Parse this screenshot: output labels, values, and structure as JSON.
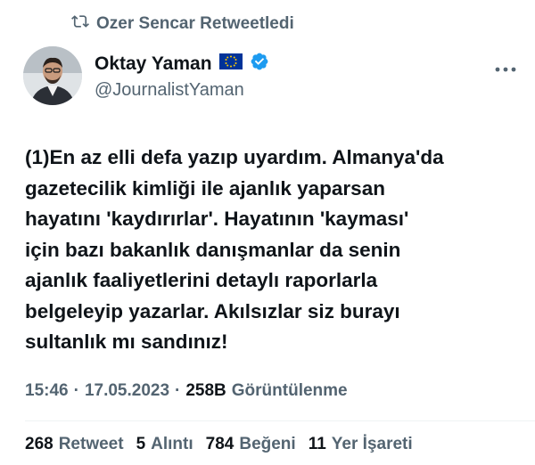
{
  "retweet": {
    "icon": "retweet-icon",
    "label": "Ozer Sencar Retweetledi"
  },
  "author": {
    "name": "Oktay Yaman",
    "flag": "eu-flag-icon",
    "verified_icon": "verified-badge-icon",
    "handle": "@JournalistYaman"
  },
  "more_icon": "more-icon",
  "tweet": {
    "text": "(1)En az elli defa yazıp uyardım. Almanya'da\ngazetecilik kimliği ile ajanlık yaparsan\nhayatını 'kaydırırlar'. Hayatının 'kayması'\niçin bazı bakanlık danışmanlar da senin\najanlık faaliyetlerini detaylı raporlarla\nbelgeleyip yazarlar. Akılsızlar siz burayı\nsultanlık mı sandınız!"
  },
  "meta": {
    "time": "15:46",
    "dot1": "·",
    "date": "17.05.2023",
    "dot2": "·",
    "views_count": "258B",
    "views_label": "Görüntülenme"
  },
  "stats": {
    "retweets_count": "268",
    "retweets_label": "Retweet",
    "quotes_count": "5",
    "quotes_label": "Alıntı",
    "likes_count": "784",
    "likes_label": "Beğeni",
    "bookmarks_count": "11",
    "bookmarks_label": "Yer İşareti"
  },
  "colors": {
    "text": "#0f1419",
    "secondary": "#536471",
    "verified": "#1d9bf0",
    "eu_blue": "#003399",
    "eu_star": "#ffcc00"
  }
}
